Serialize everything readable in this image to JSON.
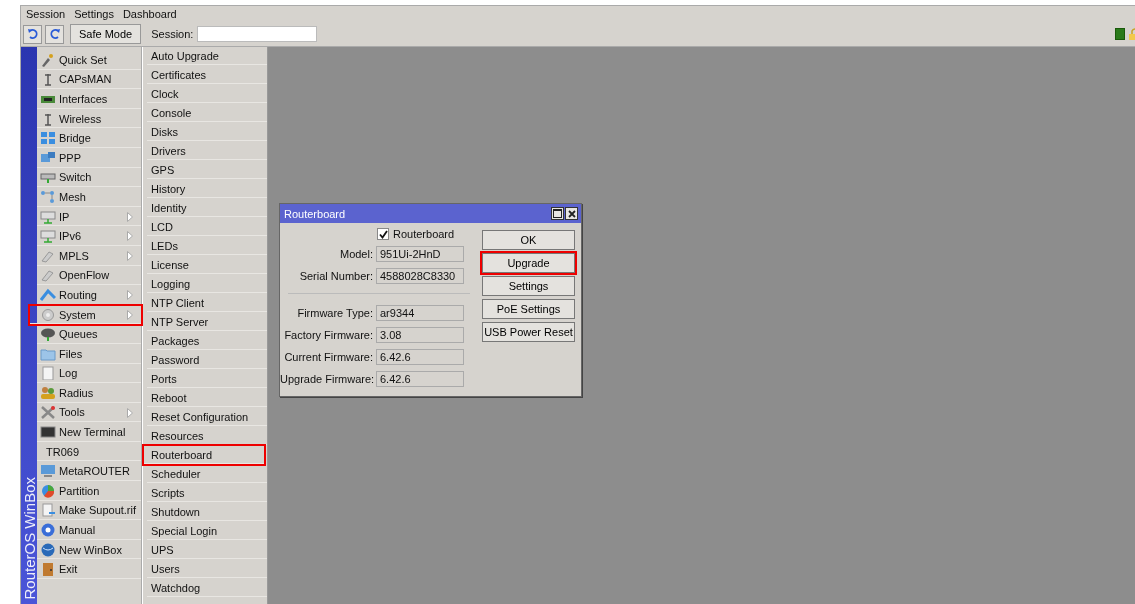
{
  "menu_bar": [
    "Session",
    "Settings",
    "Dashboard"
  ],
  "toolbar": {
    "safe_mode": "Safe Mode",
    "session_label": "Session:"
  },
  "sidebar": {
    "brand": "RouterOS WinBox",
    "items": [
      {
        "label": "Quick Set",
        "submenu": false,
        "highlighted": false
      },
      {
        "label": "CAPsMAN",
        "submenu": false,
        "highlighted": false
      },
      {
        "label": "Interfaces",
        "submenu": false,
        "highlighted": false
      },
      {
        "label": "Wireless",
        "submenu": false,
        "highlighted": false
      },
      {
        "label": "Bridge",
        "submenu": false,
        "highlighted": false
      },
      {
        "label": "PPP",
        "submenu": false,
        "highlighted": false
      },
      {
        "label": "Switch",
        "submenu": false,
        "highlighted": false
      },
      {
        "label": "Mesh",
        "submenu": false,
        "highlighted": false
      },
      {
        "label": "IP",
        "submenu": true,
        "highlighted": false
      },
      {
        "label": "IPv6",
        "submenu": true,
        "highlighted": false
      },
      {
        "label": "MPLS",
        "submenu": true,
        "highlighted": false
      },
      {
        "label": "OpenFlow",
        "submenu": false,
        "highlighted": false
      },
      {
        "label": "Routing",
        "submenu": true,
        "highlighted": false
      },
      {
        "label": "System",
        "submenu": true,
        "highlighted": true
      },
      {
        "label": "Queues",
        "submenu": false,
        "highlighted": false
      },
      {
        "label": "Files",
        "submenu": false,
        "highlighted": false
      },
      {
        "label": "Log",
        "submenu": false,
        "highlighted": false
      },
      {
        "label": "Radius",
        "submenu": false,
        "highlighted": false
      },
      {
        "label": "Tools",
        "submenu": true,
        "highlighted": false
      },
      {
        "label": "New Terminal",
        "submenu": false,
        "highlighted": false
      },
      {
        "label": "TR069",
        "submenu": false,
        "highlighted": false
      },
      {
        "label": "MetaROUTER",
        "submenu": false,
        "highlighted": false
      },
      {
        "label": "Partition",
        "submenu": false,
        "highlighted": false
      },
      {
        "label": "Make Supout.rif",
        "submenu": false,
        "highlighted": false
      },
      {
        "label": "Manual",
        "submenu": false,
        "highlighted": false
      },
      {
        "label": "New WinBox",
        "submenu": false,
        "highlighted": false
      },
      {
        "label": "Exit",
        "submenu": false,
        "highlighted": false
      }
    ]
  },
  "submenu": [
    {
      "label": "Auto Upgrade",
      "highlighted": false
    },
    {
      "label": "Certificates",
      "highlighted": false
    },
    {
      "label": "Clock",
      "highlighted": false
    },
    {
      "label": "Console",
      "highlighted": false
    },
    {
      "label": "Disks",
      "highlighted": false
    },
    {
      "label": "Drivers",
      "highlighted": false
    },
    {
      "label": "GPS",
      "highlighted": false
    },
    {
      "label": "History",
      "highlighted": false
    },
    {
      "label": "Identity",
      "highlighted": false
    },
    {
      "label": "LCD",
      "highlighted": false
    },
    {
      "label": "LEDs",
      "highlighted": false
    },
    {
      "label": "License",
      "highlighted": false
    },
    {
      "label": "Logging",
      "highlighted": false
    },
    {
      "label": "NTP Client",
      "highlighted": false
    },
    {
      "label": "NTP Server",
      "highlighted": false
    },
    {
      "label": "Packages",
      "highlighted": false
    },
    {
      "label": "Password",
      "highlighted": false
    },
    {
      "label": "Ports",
      "highlighted": false
    },
    {
      "label": "Reboot",
      "highlighted": false
    },
    {
      "label": "Reset Configuration",
      "highlighted": false
    },
    {
      "label": "Resources",
      "highlighted": false
    },
    {
      "label": "Routerboard",
      "highlighted": true
    },
    {
      "label": "Scheduler",
      "highlighted": false
    },
    {
      "label": "Scripts",
      "highlighted": false
    },
    {
      "label": "Shutdown",
      "highlighted": false
    },
    {
      "label": "Special Login",
      "highlighted": false
    },
    {
      "label": "UPS",
      "highlighted": false
    },
    {
      "label": "Users",
      "highlighted": false
    },
    {
      "label": "Watchdog",
      "highlighted": false
    }
  ],
  "dialog": {
    "title": "Routerboard",
    "checkbox": {
      "label": "Routerboard",
      "checked": true
    },
    "fields_top": [
      {
        "label": "Model:",
        "value": "951Ui-2HnD"
      },
      {
        "label": "Serial Number:",
        "value": "4588028C8330"
      }
    ],
    "fields_bottom": [
      {
        "label": "Firmware Type:",
        "value": "ar9344"
      },
      {
        "label": "Factory Firmware:",
        "value": "3.08"
      },
      {
        "label": "Current Firmware:",
        "value": "6.42.6"
      },
      {
        "label": "Upgrade Firmware:",
        "value": "6.42.6"
      }
    ],
    "buttons": [
      {
        "label": "OK",
        "highlighted": false
      },
      {
        "label": "Upgrade",
        "highlighted": true
      },
      {
        "label": "Settings",
        "highlighted": false
      },
      {
        "label": "PoE Settings",
        "highlighted": false
      },
      {
        "label": "USB Power Reset",
        "highlighted": false
      }
    ]
  }
}
